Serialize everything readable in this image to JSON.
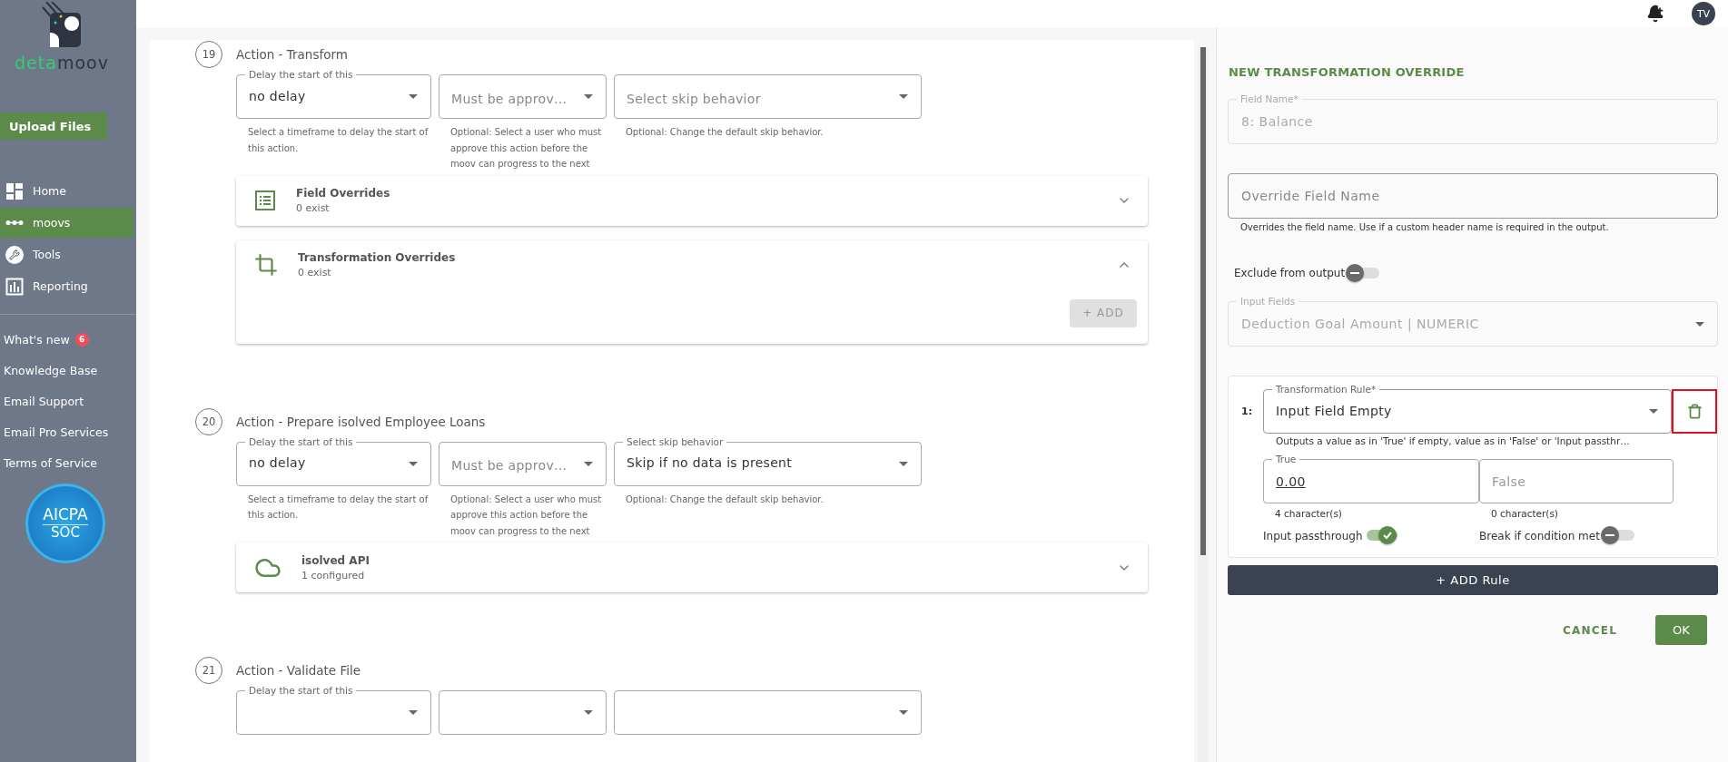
{
  "sidebar": {
    "logo": {
      "part_1": "deta",
      "part_2": "moov"
    },
    "upload_button": "Upload Files",
    "nav": [
      {
        "label": "Home",
        "kind": "grid",
        "selected": false
      },
      {
        "label": "moovs",
        "kind": "dots",
        "selected": true
      },
      {
        "label": "Tools",
        "kind": "wrench",
        "selected": false
      },
      {
        "label": "Reporting",
        "kind": "chart",
        "selected": false
      }
    ],
    "links": [
      {
        "label": "What's new",
        "badge": "6"
      },
      {
        "label": "Knowledge Base"
      },
      {
        "label": "Email Support"
      },
      {
        "label": "Email Pro Services"
      },
      {
        "label": "Terms of Service"
      }
    ],
    "certification": {
      "line_1": "AICPA",
      "line_2": "SOC"
    }
  },
  "top_bar": {
    "avatar": "TV"
  },
  "steps": [
    {
      "number": "19",
      "title": "Action - Transform",
      "fields": [
        {
          "kind": "select",
          "label": "Delay the start of this",
          "value": "no delay",
          "helper": "Select a timeframe to delay the start of this action."
        },
        {
          "kind": "select",
          "placeholder": "Must be approv…",
          "helper": "Optional: Select a user who must approve this action before the moov can progress to the next"
        },
        {
          "kind": "select",
          "placeholder": "Select skip behavior",
          "helper": "Optional: Change the default skip behavior."
        }
      ],
      "panels": [
        {
          "kind": "list",
          "title": "Field Overrides",
          "subtitle": "0 exist",
          "expanded": false
        },
        {
          "kind": "crop",
          "title": "Transformation Overrides",
          "subtitle": "0 exist",
          "expanded": true,
          "add_button": {
            "label": "+ ADD",
            "disabled": true
          }
        }
      ]
    },
    {
      "number": "20",
      "title": "Action - Prepare isolved Employee Loans",
      "fields": [
        {
          "kind": "select",
          "label": "Delay the start of this",
          "value": "no delay",
          "helper": "Select a timeframe to delay the start of this action."
        },
        {
          "kind": "select",
          "placeholder": "Must be approv…",
          "helper": "Optional: Select a user who must approve this action before the moov can progress to the next"
        },
        {
          "kind": "select",
          "label": "Select skip behavior",
          "value": "Skip if no data is present",
          "helper": "Optional: Change the default skip behavior."
        }
      ],
      "panels": [
        {
          "kind": "cloud",
          "title": "isolved API",
          "subtitle": "1 configured",
          "expanded": false
        }
      ]
    },
    {
      "number": "21",
      "title": "Action - Validate File",
      "fields": [
        {
          "kind": "select",
          "label": "Delay the start of this"
        },
        {
          "kind": "select"
        },
        {
          "kind": "select"
        }
      ]
    }
  ],
  "override_form": {
    "title": "NEW TRANSFORMATION OVERRIDE",
    "field_name": {
      "label": "Field Name*",
      "value": "8: Balance",
      "disabled": true
    },
    "override_name": {
      "placeholder": "Override Field Name",
      "helper": "Overrides the field name. Use if a custom header name is required in the output."
    },
    "exclude": {
      "label": "Exclude from output",
      "on": false
    },
    "input_fields": {
      "label": "Input Fields",
      "value": "Deduction Goal Amount | NUMERIC",
      "disabled": true
    },
    "rules": [
      {
        "index": "1:",
        "rule": {
          "label": "Transformation Rule*",
          "value": "Input Field Empty",
          "helper": "Outputs a value as in 'True' if empty, value as in 'False' or 'Input passthr…"
        },
        "true_field": {
          "label": "True",
          "value": "0.00",
          "count": "4 character(s)"
        },
        "false_field": {
          "placeholder": "False",
          "count": "0 character(s)"
        },
        "passthrough": {
          "label": "Input passthrough",
          "on": true
        },
        "break": {
          "label": "Break if condition met",
          "on": false
        },
        "delete_highlighted": true
      }
    ],
    "add_rule": "+ ADD Rule",
    "cancel": "CANCEL",
    "ok": "OK"
  }
}
